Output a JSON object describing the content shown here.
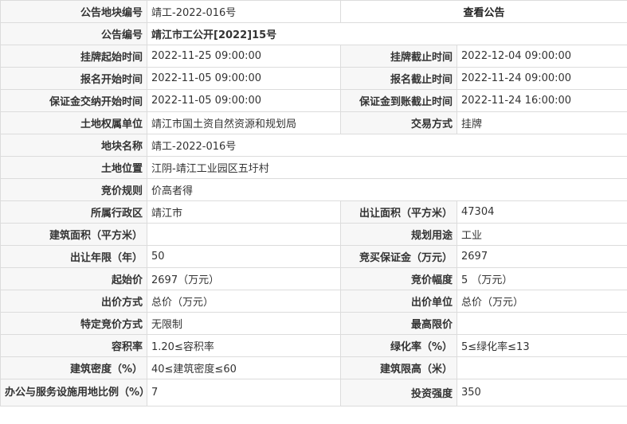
{
  "rows": [
    {
      "type": "notice",
      "label": "公告地块编号",
      "value": "靖工-2022-016号",
      "link": "查看公告"
    },
    {
      "type": "wide",
      "label": "公告编号",
      "value": "靖江市工公开[2022]15号"
    },
    {
      "type": "pair",
      "l1": "挂牌起始时间",
      "v1": "2022-11-25 09:00:00",
      "l2": "挂牌截止时间",
      "v2": "2022-12-04 09:00:00"
    },
    {
      "type": "pair",
      "l1": "报名开始时间",
      "v1": "2022-11-05 09:00:00",
      "l2": "报名截止时间",
      "v2": "2022-11-24 09:00:00"
    },
    {
      "type": "pair",
      "l1": "保证金交纳开始时间",
      "v1": "2022-11-05 09:00:00",
      "l2": "保证金到账截止时间",
      "v2": "2022-11-24 16:00:00"
    },
    {
      "type": "pair",
      "l1": "土地权属单位",
      "v1": "靖江市国土资自然资源和规划局",
      "l2": "交易方式",
      "v2": "挂牌"
    },
    {
      "type": "wide",
      "label": "地块名称",
      "value": "靖工-2022-016号"
    },
    {
      "type": "wide",
      "label": "土地位置",
      "value": "江阴-靖江工业园区五圩村"
    },
    {
      "type": "wide",
      "label": "竞价规则",
      "value": "价高者得"
    },
    {
      "type": "pair",
      "l1": "所属行政区",
      "v1": "靖江市",
      "l2": "出让面积（平方米）",
      "v2": "47304"
    },
    {
      "type": "pair",
      "l1": "建筑面积（平方米）",
      "v1": "",
      "l2": "规划用途",
      "v2": "工业"
    },
    {
      "type": "pair",
      "l1": "出让年限（年）",
      "v1": "50",
      "l2": "竞买保证金（万元）",
      "v2": "2697"
    },
    {
      "type": "pair",
      "l1": "起始价",
      "v1": "2697（万元）",
      "l2": "竞价幅度",
      "v2": "5 （万元）"
    },
    {
      "type": "pair",
      "l1": "出价方式",
      "v1": "总价（万元）",
      "l2": "出价单位",
      "v2": "总价（万元）"
    },
    {
      "type": "pair",
      "l1": "特定竞价方式",
      "v1": "无限制",
      "l2": "最高限价",
      "v2": ""
    },
    {
      "type": "pair",
      "l1": "容积率",
      "v1": "1.20≤容积率",
      "l2": "绿化率（%）",
      "v2": "5≤绿化率≤13"
    },
    {
      "type": "pair",
      "l1": "建筑密度（%）",
      "v1": "40≤建筑密度≤60",
      "l2": "建筑限高（米）",
      "v2": ""
    },
    {
      "type": "pair",
      "l1": "办公与服务设施用地比例（%）",
      "v1": "7",
      "l2": "投资强度",
      "v2": "350",
      "wrap": true
    }
  ]
}
